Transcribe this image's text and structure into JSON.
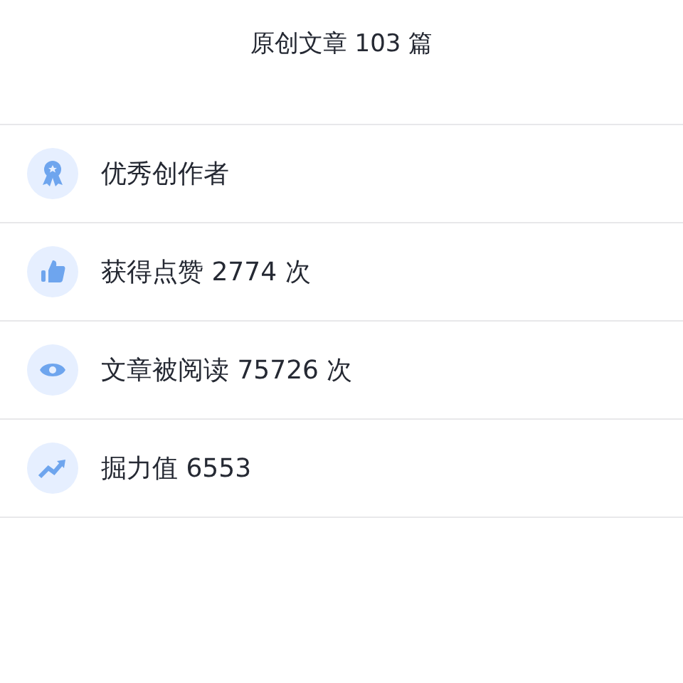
{
  "header": {
    "title": "原创文章 103 篇"
  },
  "stats": [
    {
      "kind": "award",
      "label": "优秀创作者"
    },
    {
      "kind": "like",
      "label": "获得点赞 2774 次"
    },
    {
      "kind": "view",
      "label": "文章被阅读 75726 次"
    },
    {
      "kind": "trend",
      "label": "掘力值 6553"
    }
  ]
}
